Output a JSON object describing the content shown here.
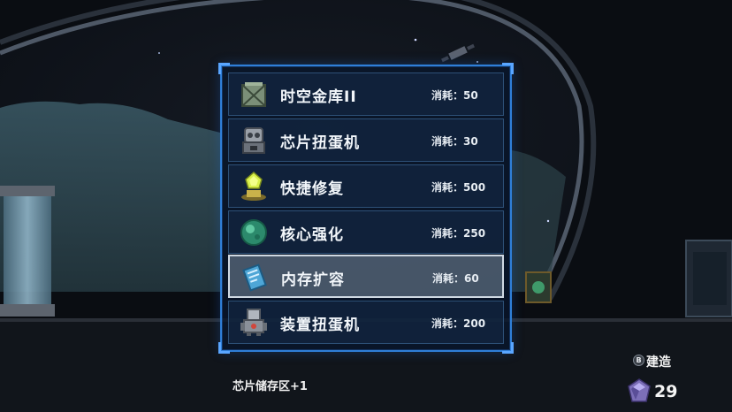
{
  "build_menu": {
    "items": [
      {
        "name": "时空金库II",
        "cost_label": "消耗：50",
        "icon": "vault-crate-icon",
        "selected": false
      },
      {
        "name": "芯片扭蛋机",
        "cost_label": "消耗：30",
        "icon": "chip-gacha-machine-icon",
        "selected": false
      },
      {
        "name": "快捷修复",
        "cost_label": "消耗：500",
        "icon": "quick-repair-pad-icon",
        "selected": false
      },
      {
        "name": "核心强化",
        "cost_label": "消耗：250",
        "icon": "core-orb-icon",
        "selected": false
      },
      {
        "name": "内存扩容",
        "cost_label": "消耗：60",
        "icon": "memory-scroll-icon",
        "selected": true
      },
      {
        "name": "装置扭蛋机",
        "cost_label": "消耗：200",
        "icon": "device-gacha-machine-icon",
        "selected": false
      }
    ]
  },
  "selected_description": "芯片储存区+1",
  "hud": {
    "build_button_glyph": "B",
    "build_label": "建造",
    "currency_amount": "29",
    "currency_icon": "crystal-gem-icon"
  },
  "colors": {
    "panel_border": "#2f7fd8",
    "selected_row": "#cfd8e2",
    "background": "#0b0e14"
  }
}
